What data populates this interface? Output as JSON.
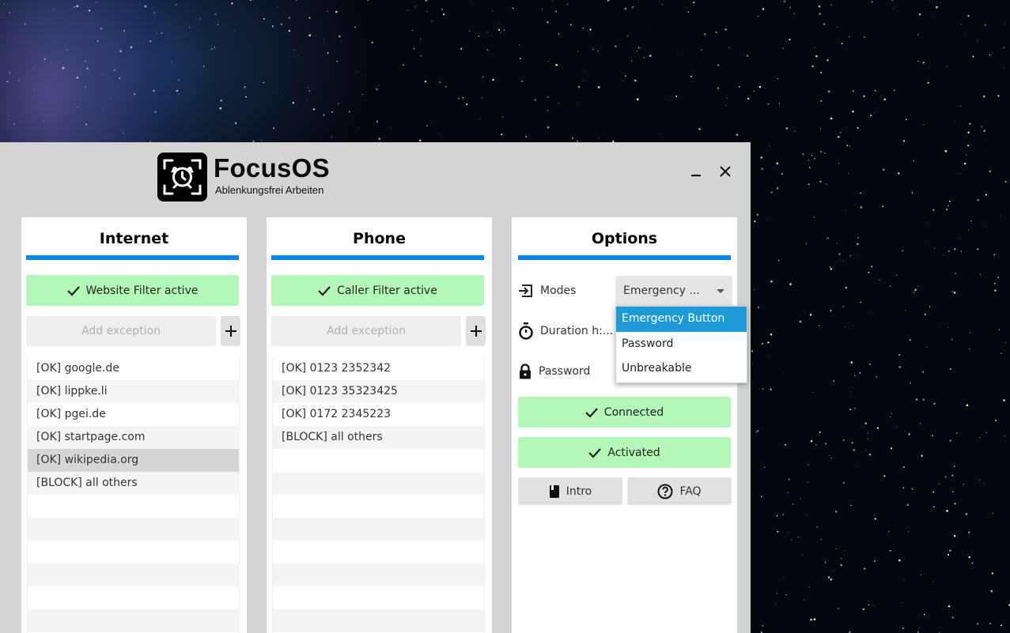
{
  "app": {
    "name": "FocusOS",
    "tagline": "Ablenkungsfrei Arbeiten",
    "logo_icon": "alarm-clock-icon",
    "window_controls": {
      "minimize_icon": "minimize-icon",
      "close_icon": "close-icon"
    }
  },
  "colors": {
    "accent": "#0a84ef",
    "status_green": "#b3f8b8",
    "selection_blue": "#1e9ad6",
    "window_bg": "#d4d4d4"
  },
  "internet": {
    "title": "Internet",
    "status_label": "Website Filter active",
    "status_icon": "checkmark-icon",
    "exception_placeholder": "Add exception",
    "exception_value": "",
    "add_label": "+",
    "items": [
      {
        "label": "[OK] google.de",
        "selected": false
      },
      {
        "label": "[OK] lippke.li",
        "selected": false
      },
      {
        "label": "[OK] pgei.de",
        "selected": false
      },
      {
        "label": "[OK] startpage.com",
        "selected": false
      },
      {
        "label": "[OK] wikipedia.org",
        "selected": true
      },
      {
        "label": "[BLOCK] all others",
        "selected": false
      }
    ]
  },
  "phone": {
    "title": "Phone",
    "status_label": "Caller Filter active",
    "status_icon": "checkmark-icon",
    "exception_placeholder": "Add exception",
    "exception_value": "",
    "add_label": "+",
    "items": [
      {
        "label": "[OK] 0123 2352342",
        "selected": false
      },
      {
        "label": "[OK] 0123 35323425",
        "selected": false
      },
      {
        "label": "[OK] 0172 2345223",
        "selected": false
      },
      {
        "label": "[BLOCK] all others",
        "selected": false
      }
    ]
  },
  "options": {
    "title": "Options",
    "modes_label": "Modes",
    "modes_icon": "enter-icon",
    "modes_selected": "Emergency ...",
    "modes_options": [
      "Emergency Button",
      "Password",
      "Unbreakable"
    ],
    "modes_highlighted": "Emergency Button",
    "duration_label": "Duration h:...",
    "duration_icon": "stopwatch-icon",
    "password_label": "Password",
    "password_icon": "lock-icon",
    "connected_label": "Connected",
    "activated_label": "Activated",
    "intro_label": "Intro",
    "intro_icon": "book-icon",
    "faq_label": "FAQ",
    "faq_icon": "question-circle-icon"
  }
}
